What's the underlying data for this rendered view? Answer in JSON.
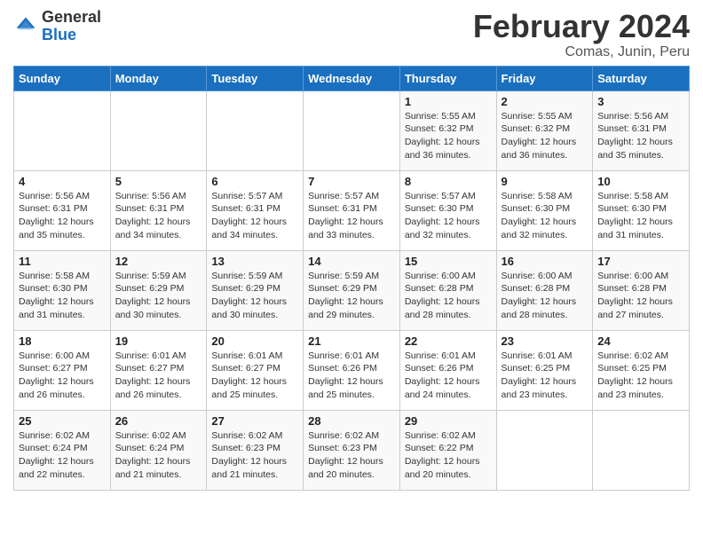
{
  "logo": {
    "general": "General",
    "blue": "Blue"
  },
  "title": "February 2024",
  "subtitle": "Comas, Junin, Peru",
  "days_header": [
    "Sunday",
    "Monday",
    "Tuesday",
    "Wednesday",
    "Thursday",
    "Friday",
    "Saturday"
  ],
  "weeks": [
    [
      {
        "day": "",
        "info": ""
      },
      {
        "day": "",
        "info": ""
      },
      {
        "day": "",
        "info": ""
      },
      {
        "day": "",
        "info": ""
      },
      {
        "day": "1",
        "info": "Sunrise: 5:55 AM\nSunset: 6:32 PM\nDaylight: 12 hours\nand 36 minutes."
      },
      {
        "day": "2",
        "info": "Sunrise: 5:55 AM\nSunset: 6:32 PM\nDaylight: 12 hours\nand 36 minutes."
      },
      {
        "day": "3",
        "info": "Sunrise: 5:56 AM\nSunset: 6:31 PM\nDaylight: 12 hours\nand 35 minutes."
      }
    ],
    [
      {
        "day": "4",
        "info": "Sunrise: 5:56 AM\nSunset: 6:31 PM\nDaylight: 12 hours\nand 35 minutes."
      },
      {
        "day": "5",
        "info": "Sunrise: 5:56 AM\nSunset: 6:31 PM\nDaylight: 12 hours\nand 34 minutes."
      },
      {
        "day": "6",
        "info": "Sunrise: 5:57 AM\nSunset: 6:31 PM\nDaylight: 12 hours\nand 34 minutes."
      },
      {
        "day": "7",
        "info": "Sunrise: 5:57 AM\nSunset: 6:31 PM\nDaylight: 12 hours\nand 33 minutes."
      },
      {
        "day": "8",
        "info": "Sunrise: 5:57 AM\nSunset: 6:30 PM\nDaylight: 12 hours\nand 32 minutes."
      },
      {
        "day": "9",
        "info": "Sunrise: 5:58 AM\nSunset: 6:30 PM\nDaylight: 12 hours\nand 32 minutes."
      },
      {
        "day": "10",
        "info": "Sunrise: 5:58 AM\nSunset: 6:30 PM\nDaylight: 12 hours\nand 31 minutes."
      }
    ],
    [
      {
        "day": "11",
        "info": "Sunrise: 5:58 AM\nSunset: 6:30 PM\nDaylight: 12 hours\nand 31 minutes."
      },
      {
        "day": "12",
        "info": "Sunrise: 5:59 AM\nSunset: 6:29 PM\nDaylight: 12 hours\nand 30 minutes."
      },
      {
        "day": "13",
        "info": "Sunrise: 5:59 AM\nSunset: 6:29 PM\nDaylight: 12 hours\nand 30 minutes."
      },
      {
        "day": "14",
        "info": "Sunrise: 5:59 AM\nSunset: 6:29 PM\nDaylight: 12 hours\nand 29 minutes."
      },
      {
        "day": "15",
        "info": "Sunrise: 6:00 AM\nSunset: 6:28 PM\nDaylight: 12 hours\nand 28 minutes."
      },
      {
        "day": "16",
        "info": "Sunrise: 6:00 AM\nSunset: 6:28 PM\nDaylight: 12 hours\nand 28 minutes."
      },
      {
        "day": "17",
        "info": "Sunrise: 6:00 AM\nSunset: 6:28 PM\nDaylight: 12 hours\nand 27 minutes."
      }
    ],
    [
      {
        "day": "18",
        "info": "Sunrise: 6:00 AM\nSunset: 6:27 PM\nDaylight: 12 hours\nand 26 minutes."
      },
      {
        "day": "19",
        "info": "Sunrise: 6:01 AM\nSunset: 6:27 PM\nDaylight: 12 hours\nand 26 minutes."
      },
      {
        "day": "20",
        "info": "Sunrise: 6:01 AM\nSunset: 6:27 PM\nDaylight: 12 hours\nand 25 minutes."
      },
      {
        "day": "21",
        "info": "Sunrise: 6:01 AM\nSunset: 6:26 PM\nDaylight: 12 hours\nand 25 minutes."
      },
      {
        "day": "22",
        "info": "Sunrise: 6:01 AM\nSunset: 6:26 PM\nDaylight: 12 hours\nand 24 minutes."
      },
      {
        "day": "23",
        "info": "Sunrise: 6:01 AM\nSunset: 6:25 PM\nDaylight: 12 hours\nand 23 minutes."
      },
      {
        "day": "24",
        "info": "Sunrise: 6:02 AM\nSunset: 6:25 PM\nDaylight: 12 hours\nand 23 minutes."
      }
    ],
    [
      {
        "day": "25",
        "info": "Sunrise: 6:02 AM\nSunset: 6:24 PM\nDaylight: 12 hours\nand 22 minutes."
      },
      {
        "day": "26",
        "info": "Sunrise: 6:02 AM\nSunset: 6:24 PM\nDaylight: 12 hours\nand 21 minutes."
      },
      {
        "day": "27",
        "info": "Sunrise: 6:02 AM\nSunset: 6:23 PM\nDaylight: 12 hours\nand 21 minutes."
      },
      {
        "day": "28",
        "info": "Sunrise: 6:02 AM\nSunset: 6:23 PM\nDaylight: 12 hours\nand 20 minutes."
      },
      {
        "day": "29",
        "info": "Sunrise: 6:02 AM\nSunset: 6:22 PM\nDaylight: 12 hours\nand 20 minutes."
      },
      {
        "day": "",
        "info": ""
      },
      {
        "day": "",
        "info": ""
      }
    ]
  ]
}
